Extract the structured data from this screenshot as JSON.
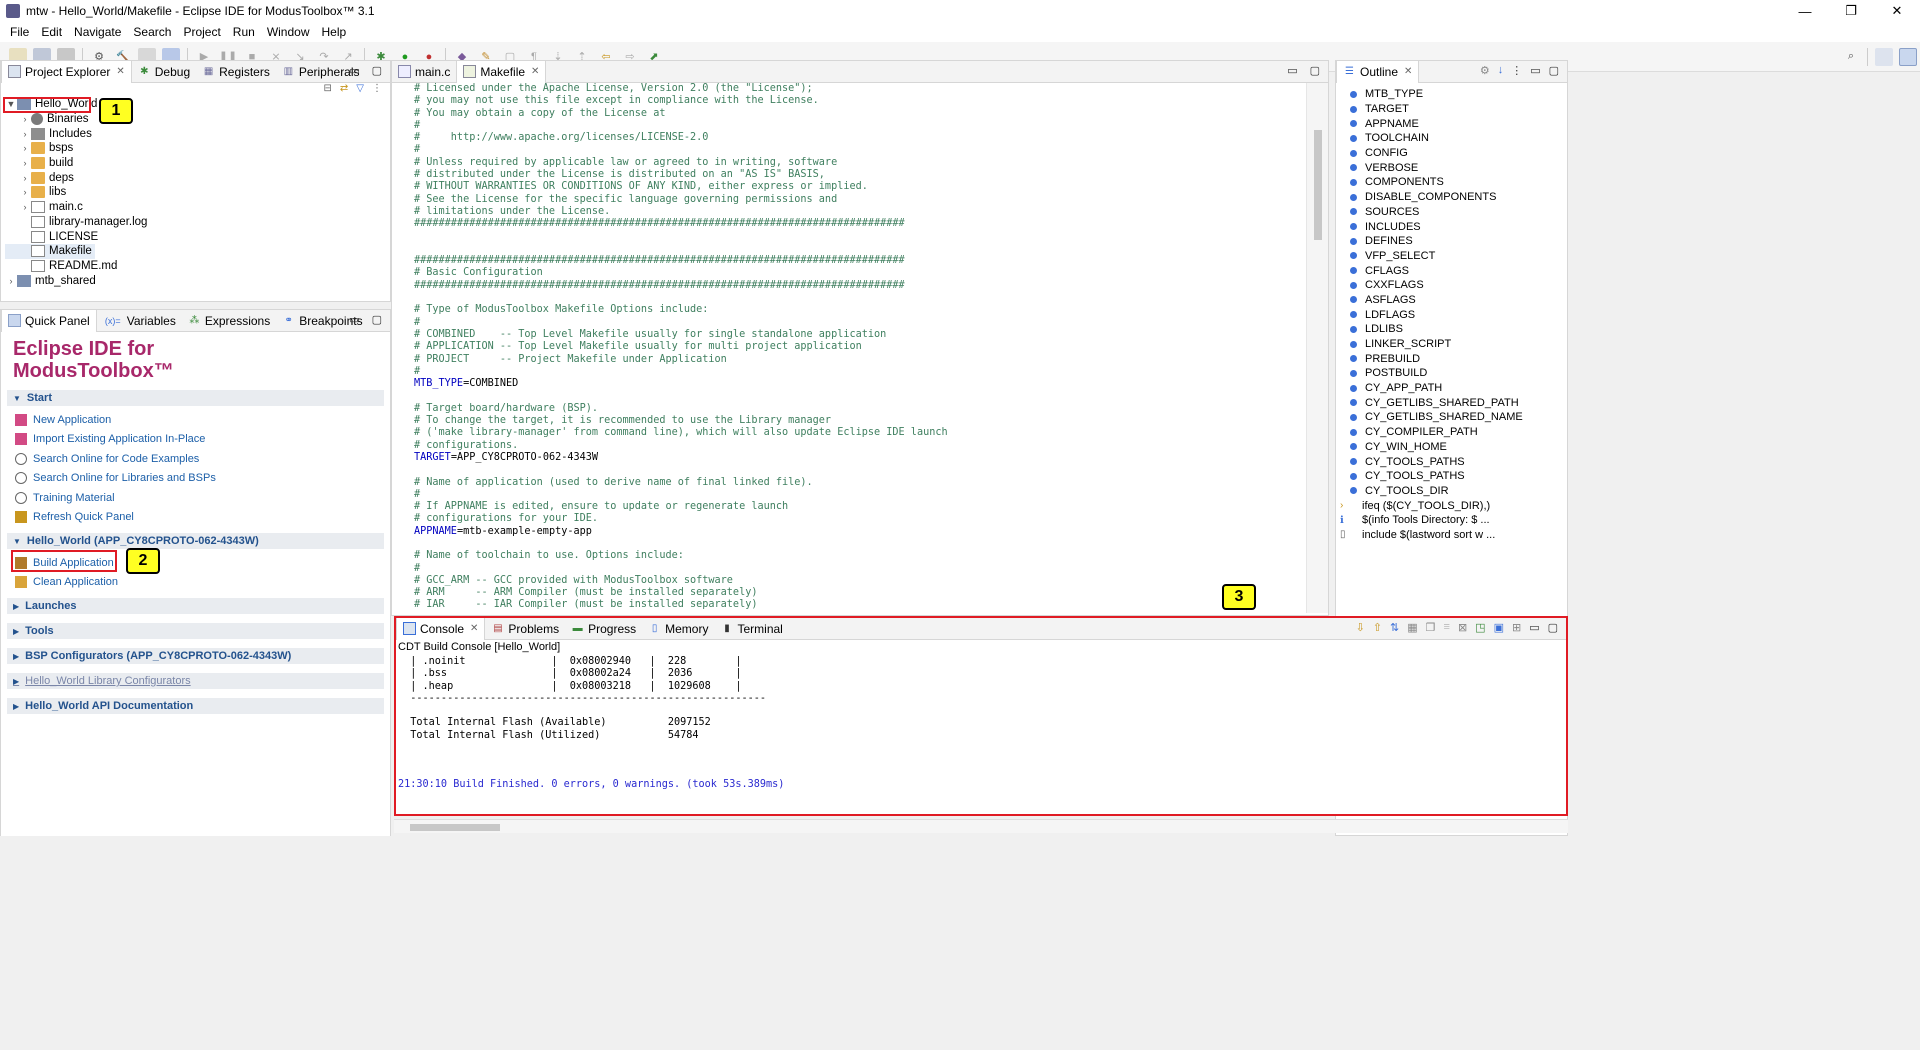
{
  "window": {
    "title": "mtw - Hello_World/Makefile - Eclipse IDE for ModusToolbox™ 3.1",
    "minimize_glyph": "—",
    "restore_glyph": "❐",
    "close_glyph": "✕"
  },
  "menu": [
    "File",
    "Edit",
    "Navigate",
    "Search",
    "Project",
    "Run",
    "Window",
    "Help"
  ],
  "project_explorer": {
    "tabs": [
      "Project Explorer",
      "Debug",
      "Registers",
      "Peripherals"
    ],
    "tree": [
      {
        "label": "Hello_World",
        "depth": 0,
        "icon": "project-icon",
        "twisty": "▼"
      },
      {
        "label": "Binaries",
        "depth": 1,
        "icon": "binaries-icon",
        "twisty": "›"
      },
      {
        "label": "Includes",
        "depth": 1,
        "icon": "includes-icon",
        "twisty": "›"
      },
      {
        "label": "bsps",
        "depth": 1,
        "icon": "folder-icon",
        "twisty": "›"
      },
      {
        "label": "build",
        "depth": 1,
        "icon": "folder-icon",
        "twisty": "›"
      },
      {
        "label": "deps",
        "depth": 1,
        "icon": "folder-icon",
        "twisty": "›"
      },
      {
        "label": "libs",
        "depth": 1,
        "icon": "folder-icon",
        "twisty": "›"
      },
      {
        "label": "main.c",
        "depth": 1,
        "icon": "c-file-icon",
        "twisty": "›"
      },
      {
        "label": "library-manager.log",
        "depth": 1,
        "icon": "file-icon",
        "twisty": ""
      },
      {
        "label": "LICENSE",
        "depth": 1,
        "icon": "file-icon",
        "twisty": ""
      },
      {
        "label": "Makefile",
        "depth": 1,
        "icon": "makefile-icon",
        "twisty": ""
      },
      {
        "label": "README.md",
        "depth": 1,
        "icon": "file-icon",
        "twisty": ""
      },
      {
        "label": "mtb_shared",
        "depth": 0,
        "icon": "project-icon",
        "twisty": "›"
      }
    ]
  },
  "quick_panel": {
    "tabs": [
      "Quick Panel",
      "Variables",
      "Expressions",
      "Breakpoints"
    ],
    "variables_prefix": "(x)=",
    "title_line1": "Eclipse IDE for",
    "title_line2": "ModusToolbox™",
    "sections": [
      {
        "title": "Start",
        "expanded": true,
        "links": [
          "New Application",
          "Import Existing Application In-Place",
          "Search Online for Code Examples",
          "Search Online for Libraries and BSPs",
          "Training Material",
          "Refresh Quick Panel"
        ]
      },
      {
        "title": "Hello_World (APP_CY8CPROTO-062-4343W)",
        "expanded": true,
        "links": [
          "Build Application",
          "Clean Application"
        ]
      },
      {
        "title": "Launches",
        "expanded": false,
        "links": []
      },
      {
        "title": "Tools",
        "expanded": false,
        "links": []
      },
      {
        "title": "BSP Configurators (APP_CY8CPROTO-062-4343W)",
        "expanded": false,
        "links": []
      },
      {
        "title": "Hello_World Library Configurators",
        "expanded": false,
        "links": []
      },
      {
        "title": "Hello_World API Documentation",
        "expanded": false,
        "links": []
      }
    ]
  },
  "editor": {
    "tabs": [
      "main.c",
      "Makefile"
    ],
    "lines": [
      "# Licensed under the Apache License, Version 2.0 (the \"License\");",
      "# you may not use this file except in compliance with the License.",
      "# You may obtain a copy of the License at",
      "#",
      "#     http://www.apache.org/licenses/LICENSE-2.0",
      "#",
      "# Unless required by applicable law or agreed to in writing, software",
      "# distributed under the License is distributed on an \"AS IS\" BASIS,",
      "# WITHOUT WARRANTIES OR CONDITIONS OF ANY KIND, either express or implied.",
      "# See the License for the specific language governing permissions and",
      "# limitations under the License.",
      "################################################################################",
      "",
      "",
      "################################################################################",
      "# Basic Configuration",
      "################################################################################",
      "",
      "# Type of ModusToolbox Makefile Options include:",
      "#",
      "# COMBINED    -- Top Level Makefile usually for single standalone application",
      "# APPLICATION -- Top Level Makefile usually for multi project application",
      "# PROJECT     -- Project Makefile under Application",
      "#",
      "MTB_TYPE=COMBINED",
      "",
      "# Target board/hardware (BSP).",
      "# To change the target, it is recommended to use the Library manager",
      "# ('make library-manager' from command line), which will also update Eclipse IDE launch",
      "# configurations.",
      "TARGET=APP_CY8CPROTO-062-4343W",
      "",
      "# Name of application (used to derive name of final linked file).",
      "#",
      "# If APPNAME is edited, ensure to update or regenerate launch",
      "# configurations for your IDE.",
      "APPNAME=mtb-example-empty-app",
      "",
      "# Name of toolchain to use. Options include:",
      "#",
      "# GCC_ARM -- GCC provided with ModusToolbox software",
      "# ARM     -- ARM Compiler (must be installed separately)",
      "# IAR     -- IAR Compiler (must be installed separately)"
    ]
  },
  "outline": {
    "tabs": [
      "Outline"
    ],
    "items": [
      "MTB_TYPE",
      "TARGET",
      "APPNAME",
      "TOOLCHAIN",
      "CONFIG",
      "VERBOSE",
      "COMPONENTS",
      "DISABLE_COMPONENTS",
      "SOURCES",
      "INCLUDES",
      "DEFINES",
      "VFP_SELECT",
      "CFLAGS",
      "CXXFLAGS",
      "ASFLAGS",
      "LDFLAGS",
      "LDLIBS",
      "LINKER_SCRIPT",
      "PREBUILD",
      "POSTBUILD",
      "CY_APP_PATH",
      "CY_GETLIBS_SHARED_PATH",
      "CY_GETLIBS_SHARED_NAME",
      "CY_COMPILER_PATH",
      "CY_WIN_HOME",
      "CY_TOOLS_PATHS",
      "CY_TOOLS_PATHS",
      "CY_TOOLS_DIR"
    ],
    "extra": [
      "ifeq ($(CY_TOOLS_DIR),)",
      "$(info Tools Directory: $ ...",
      "include $(lastword sort w ..."
    ]
  },
  "console": {
    "tabs": [
      "Console",
      "Problems",
      "Progress",
      "Memory",
      "Terminal"
    ],
    "header": "CDT Build Console [Hello_World]",
    "lines": [
      "  | .noinit              |  0x08002940   |  228        |",
      "  | .bss                 |  0x08002a24   |  2036       |",
      "  | .heap                |  0x08003218   |  1029608    |",
      "  ----------------------------------------------------------",
      "",
      "  Total Internal Flash (Available)          2097152",
      "  Total Internal Flash (Utilized)           54784",
      "",
      "",
      "",
      "21:30:10 Build Finished. 0 errors, 0 warnings. (took 53s.389ms)"
    ]
  },
  "callouts": [
    "1",
    "2",
    "3"
  ],
  "colors": {
    "accent_title": "#a8286a",
    "link": "#1c5fa8",
    "highlight_box": "#e01b24",
    "callout_fill": "#ffff22",
    "comment": "#3f7f5f",
    "variable": "#0000c0"
  }
}
